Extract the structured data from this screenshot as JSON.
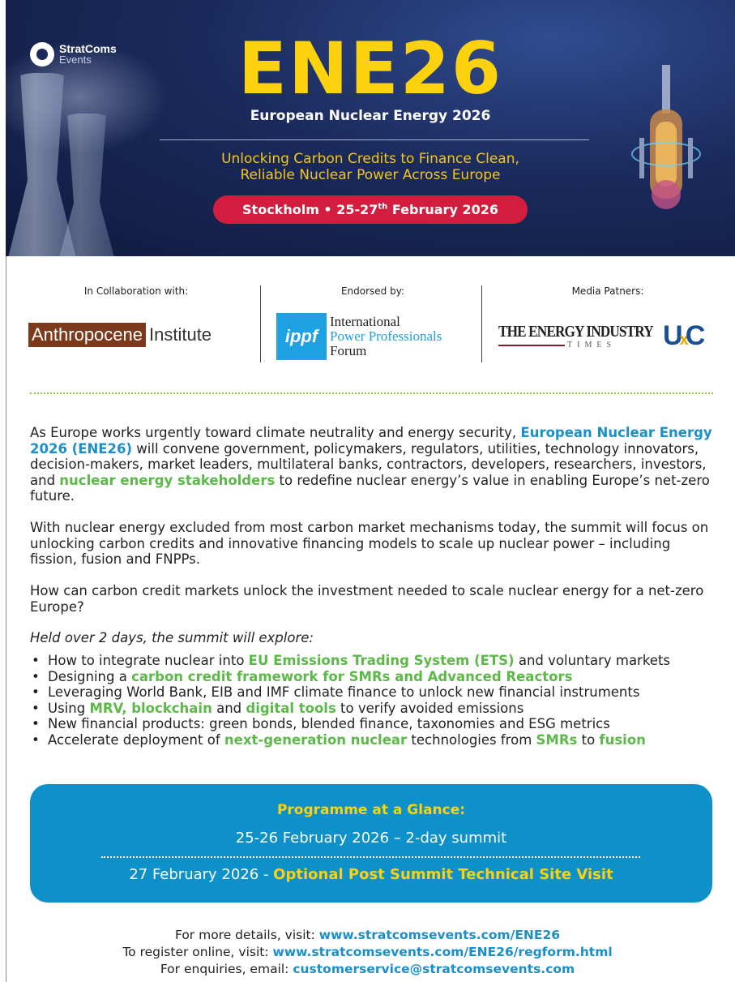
{
  "banner": {
    "brand_line1": "StratComs",
    "brand_line2": "Events",
    "title": "ENE26",
    "subtitle": "European Nuclear Energy 2026",
    "tagline_line1": "Unlocking Carbon Credits to Finance Clean,",
    "tagline_line2": "Reliable Nuclear Power Across Europe",
    "location_date_prefix": "Stockholm • 25-27",
    "location_date_sup": "th",
    "location_date_suffix": " February 2026",
    "colors": {
      "title_yellow": "#fcd20f",
      "pill_red": "#d31d3e",
      "banner_navy": "#1a2a5c"
    }
  },
  "partners": {
    "collab_heading": "In Collaboration with:",
    "collab_logo_part1": "Anthropocene",
    "collab_logo_part2": "Institute",
    "endorsed_heading": "Endorsed by:",
    "endorsed_logo_mark": "ippf",
    "endorsed_line1": "International",
    "endorsed_line2": "Power Professionals",
    "endorsed_line3": "Forum",
    "media_heading": "Media Patners:",
    "media_logo1": "THE ENERGY INDUSTRY",
    "media_logo1_sub": "TIMES",
    "media_logo2_a": "U",
    "media_logo2_b": "x",
    "media_logo2_c": "C"
  },
  "body": {
    "p1_a": "As Europe works urgently toward climate neutrality and energy security, ",
    "p1_b": "European Nuclear Energy 2026 (ENE26)",
    "p1_c": " will convene government, policymakers, regulators, utilities, technology innovators, decision-makers, market leaders, multilateral banks, contractors, developers, researchers, investors, and ",
    "p1_d": "nuclear energy stakeholders",
    "p1_e": " to redefine nuclear energy’s value in enabling Europe’s net-zero future.",
    "p2": "With nuclear energy excluded from most carbon market mechanisms today, the summit will focus on unlocking carbon credits and innovative financing models to scale up nuclear power – including fission, fusion and FNPPs.",
    "p3": "How can carbon credit markets unlock the investment needed to scale nuclear energy for a net-zero Europe?",
    "p4": "Held over 2 days, the summit will explore:",
    "b1_a": "How to integrate nuclear into ",
    "b1_b": "EU Emissions Trading System (ETS)",
    "b1_c": " and voluntary markets",
    "b2_a": "Designing a ",
    "b2_b": "carbon credit framework for SMRs and Advanced Reactors",
    "b3": "Leveraging World Bank, EIB and IMF climate finance to unlock new financial instruments",
    "b4_a": "Using ",
    "b4_b": "MRV, blockchain",
    "b4_c": " and ",
    "b4_d": "digital tools",
    "b4_e": " to verify avoided emissions",
    "b5": "New financial products: green bonds, blended finance, taxonomies and ESG metrics",
    "b6_a": "Accelerate deployment of ",
    "b6_b": "next-generation nuclear",
    "b6_c": " technologies from ",
    "b6_d": "SMRs",
    "b6_e": " to ",
    "b6_f": "fusion"
  },
  "programme": {
    "heading": "Programme at a Glance:",
    "line1": "25-26 February 2026 – 2-day summit",
    "line2_a": "27 February 2026 - ",
    "line2_b": "Optional Post Summit Technical Site Visit"
  },
  "footer": {
    "l1_a": "For more details, visit: ",
    "l1_b": "www.stratcomsevents.com/ENE26",
    "l2_a": "To register online, visit: ",
    "l2_b": "www.stratcomsevents.com/ENE26/regform.html",
    "l3_a": "For enquiries, email: ",
    "l3_b": "customerservice@stratcomsevents.com"
  }
}
